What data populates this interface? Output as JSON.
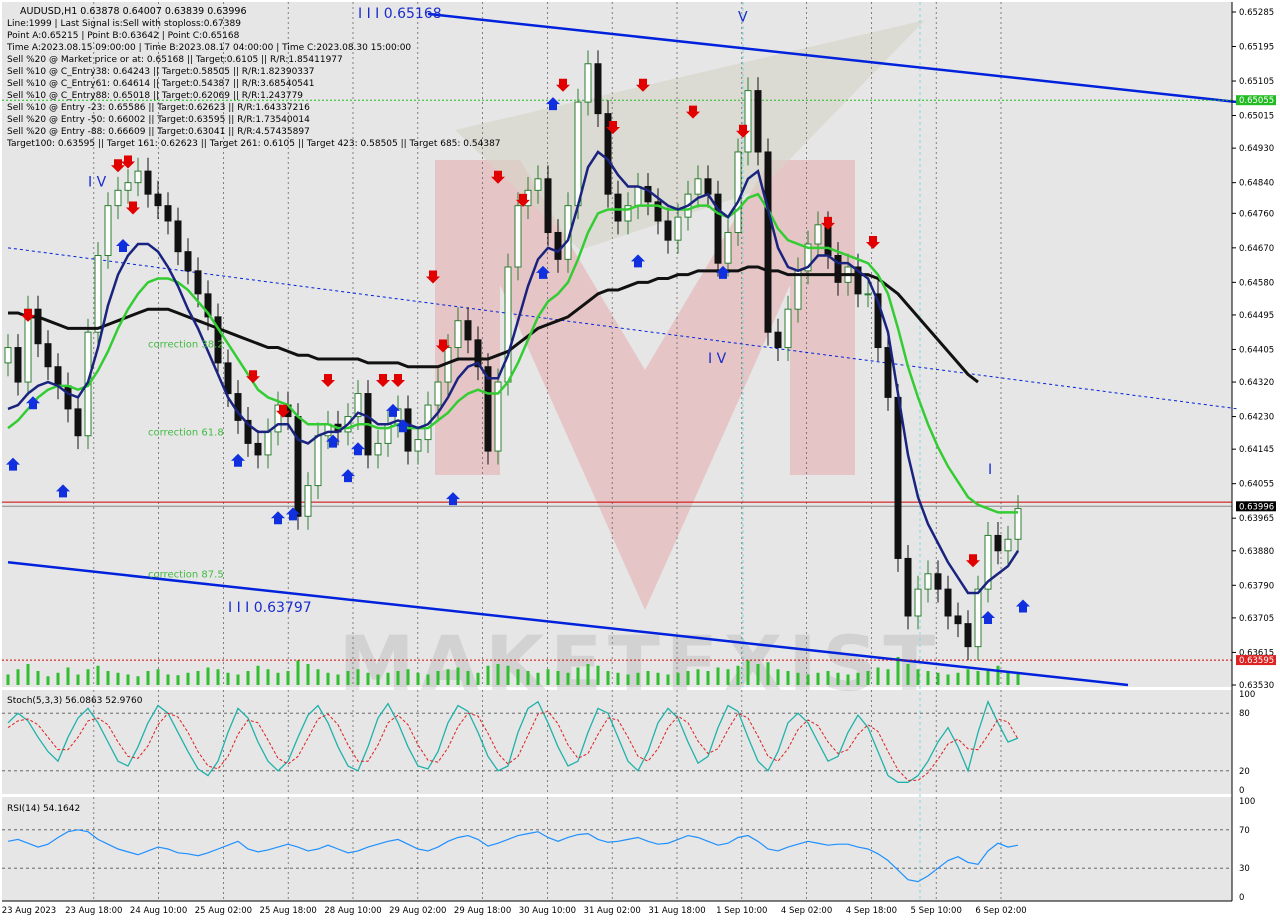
{
  "header": {
    "symbol_line": "AUDUSD,H1  0.63878 0.64007 0.63839 0.63996",
    "lines": [
      "Line:1999 | Last Signal is:Sell with stoploss:0.67389",
      "Point A:0.65215 | Point B:0.63642 | Point C:0.65168",
      "Time A:2023.08.15 09:00:00 | Time B:2023.08.17 04:00:00 | Time C:2023.08.30 15:00:00",
      "Sell %20 @ Market price or at: 0.65168 || Target:0.6105 || R/R:1.85411977",
      "Sell %10 @ C_Entry38: 0.64243 || Target:0.58505 || R/R:1.82390337",
      "Sell %10 @ C_Entry61: 0.64614 || Target:0.54387 || R/R:3.68540541",
      "Sell %10 @ C_Entry88: 0.65018 || Target:0.62069 || R/R:1.243779",
      "Sell %10 @ Entry -23: 0.65586 || Target:0.62623 || R/R:1.64337216",
      "Sell %20 @ Entry -50: 0.66002 || Target:0.63595 || R/R:1.73540014",
      "Sell %20 @ Entry -88: 0.66609 || Target:0.63041 || R/R:4.57435897",
      "Target100: 0.63595 || Target 161: 0.62623 || Target 261: 0.6105 || Target 423: 0.58505 || Target 685: 0.54387"
    ]
  },
  "wave_labels": [
    {
      "text": "I I I 0.65168",
      "t": 35,
      "p": 0.6527
    },
    {
      "text": "V",
      "t": 73,
      "p": 0.6526
    },
    {
      "text": "I V",
      "t": 8,
      "p": 0.6483
    },
    {
      "text": "I V",
      "t": 70,
      "p": 0.6437
    },
    {
      "text": "I",
      "t": 98,
      "p": 0.6408
    },
    {
      "text": "I I I 0.63797",
      "t": 22,
      "p": 0.6372
    }
  ],
  "corrections": [
    {
      "text": "correction 38.2",
      "t": 14,
      "p": 0.6441
    },
    {
      "text": "correction 61.8",
      "t": 14,
      "p": 0.6418
    },
    {
      "text": "correction 87.5",
      "t": 14,
      "p": 0.6381
    }
  ],
  "watermark": "MAKETFXIST",
  "price_axis": {
    "ticks": [
      "0.65285",
      "0.65195",
      "0.65105",
      "0.65015",
      "0.64930",
      "0.64840",
      "0.64760",
      "0.64670",
      "0.64580",
      "0.64495",
      "0.64405",
      "0.64320",
      "0.64230",
      "0.64145",
      "0.64055",
      "0.63965",
      "0.63880",
      "0.63790",
      "0.63705",
      "0.63615",
      "0.63530"
    ],
    "current_price": "0.63996",
    "red_level": "0.64007",
    "green_level": "0.65055",
    "bottom_level": "0.63595"
  },
  "time_axis": [
    "23 Aug 2023",
    "23 Aug 18:00",
    "24 Aug 10:00",
    "25 Aug 02:00",
    "25 Aug 18:00",
    "28 Aug 10:00",
    "29 Aug 02:00",
    "29 Aug 18:00",
    "30 Aug 10:00",
    "31 Aug 02:00",
    "31 Aug 18:00",
    "1 Sep 10:00",
    "4 Sep 02:00",
    "4 Sep 18:00",
    "5 Sep 10:00",
    "6 Sep 02:00"
  ],
  "stoch": {
    "label": "Stoch(5,3,3) 56.0863 52.9760",
    "levels": [
      "100",
      "80",
      "20",
      "0"
    ]
  },
  "rsi": {
    "label": "RSI(14) 54.1642",
    "levels": [
      "100",
      "70",
      "30",
      "0"
    ]
  },
  "colors": {
    "bull_candle": "#2e7d32",
    "bear_candle": "#111111",
    "ma_fast": "#1a237e",
    "ma_green": "#33cc33",
    "ma_black": "#111111",
    "channel": "#0022dd",
    "signal_red": "#e00000",
    "signal_blue": "#1030e0",
    "stoch_main": "#20b2aa",
    "stoch_signal": "#e02020",
    "rsi": "#1e90ff",
    "red_line": "#cc0000",
    "green_line": "#22bb22"
  },
  "chart_data": {
    "type": "candlestick",
    "symbol": "AUDUSD",
    "timeframe": "H1",
    "ohlc_last": {
      "open": 0.63878,
      "high": 0.64007,
      "low": 0.63839,
      "close": 0.63996
    },
    "ylim": [
      0.6353,
      0.65285
    ],
    "close": [
      0.6441,
      0.6432,
      0.6451,
      0.6442,
      0.6436,
      0.6431,
      0.6425,
      0.6418,
      0.6445,
      0.6465,
      0.6478,
      0.6482,
      0.6484,
      0.6487,
      0.6481,
      0.6478,
      0.6474,
      0.6466,
      0.6461,
      0.6455,
      0.6449,
      0.6437,
      0.6429,
      0.6422,
      0.6416,
      0.6413,
      0.6419,
      0.6426,
      0.6423,
      0.6397,
      0.6405,
      0.6418,
      0.6421,
      0.6419,
      0.6423,
      0.6429,
      0.6413,
      0.6416,
      0.6421,
      0.6425,
      0.6414,
      0.6417,
      0.6426,
      0.6432,
      0.6441,
      0.6448,
      0.6443,
      0.6436,
      0.6414,
      0.6432,
      0.6462,
      0.6478,
      0.6482,
      0.6485,
      0.6471,
      0.6464,
      0.6478,
      0.6505,
      0.6515,
      0.6502,
      0.6481,
      0.6474,
      0.6478,
      0.6483,
      0.6479,
      0.6474,
      0.6469,
      0.6475,
      0.6481,
      0.6485,
      0.6481,
      0.6463,
      0.6471,
      0.6492,
      0.6508,
      0.6492,
      0.6445,
      0.6441,
      0.6451,
      0.6461,
      0.6468,
      0.6473,
      0.6465,
      0.6458,
      0.6462,
      0.6455,
      0.6455,
      0.6441,
      0.6428,
      0.6386,
      0.6371,
      0.6378,
      0.6382,
      0.6378,
      0.6371,
      0.6369,
      0.6363,
      0.6378,
      0.6392,
      0.6388,
      0.6391,
      0.6399
    ],
    "ma_dark_blue": [
      0.6425,
      0.6426,
      0.6429,
      0.6431,
      0.6432,
      0.6431,
      0.6429,
      0.6428,
      0.6432,
      0.6441,
      0.6452,
      0.646,
      0.6465,
      0.6468,
      0.6468,
      0.6466,
      0.6462,
      0.6457,
      0.6451,
      0.6446,
      0.644,
      0.6434,
      0.6428,
      0.6424,
      0.6421,
      0.6419,
      0.6419,
      0.6421,
      0.6421,
      0.6417,
      0.6416,
      0.6418,
      0.6419,
      0.6419,
      0.6421,
      0.6424,
      0.6423,
      0.6421,
      0.6421,
      0.6422,
      0.6421,
      0.642,
      0.6421,
      0.6424,
      0.6428,
      0.6433,
      0.6436,
      0.6437,
      0.6433,
      0.6433,
      0.6439,
      0.6448,
      0.6457,
      0.6464,
      0.6467,
      0.6466,
      0.6469,
      0.6478,
      0.6488,
      0.6492,
      0.649,
      0.6486,
      0.6483,
      0.6483,
      0.6482,
      0.648,
      0.6478,
      0.6477,
      0.6478,
      0.648,
      0.6481,
      0.6477,
      0.6475,
      0.6479,
      0.6485,
      0.6487,
      0.6477,
      0.6467,
      0.6462,
      0.6461,
      0.6462,
      0.6465,
      0.6465,
      0.6463,
      0.6463,
      0.6461,
      0.6459,
      0.6453,
      0.6445,
      0.6429,
      0.6413,
      0.6402,
      0.6395,
      0.639,
      0.6385,
      0.6381,
      0.6377,
      0.6377,
      0.638,
      0.6382,
      0.6384,
      0.6388
    ],
    "ma_green": [
      0.642,
      0.6422,
      0.6425,
      0.6428,
      0.643,
      0.6431,
      0.6431,
      0.643,
      0.6431,
      0.6435,
      0.644,
      0.6446,
      0.6451,
      0.6455,
      0.6458,
      0.6459,
      0.6459,
      0.6458,
      0.6456,
      0.6453,
      0.645,
      0.6446,
      0.6442,
      0.6438,
      0.6434,
      0.643,
      0.6428,
      0.6427,
      0.6426,
      0.6423,
      0.6421,
      0.6421,
      0.6421,
      0.642,
      0.642,
      0.6421,
      0.6421,
      0.642,
      0.642,
      0.6421,
      0.642,
      0.642,
      0.642,
      0.6422,
      0.6424,
      0.6427,
      0.6429,
      0.643,
      0.6429,
      0.6429,
      0.6432,
      0.6437,
      0.6443,
      0.6449,
      0.6453,
      0.6455,
      0.6458,
      0.6464,
      0.6471,
      0.6476,
      0.6477,
      0.6477,
      0.6477,
      0.6478,
      0.6478,
      0.6478,
      0.6477,
      0.6477,
      0.6477,
      0.6478,
      0.6478,
      0.6476,
      0.6475,
      0.6477,
      0.648,
      0.6481,
      0.6477,
      0.6472,
      0.6469,
      0.6468,
      0.6467,
      0.6467,
      0.6467,
      0.6466,
      0.6465,
      0.6464,
      0.6463,
      0.646,
      0.6455,
      0.6446,
      0.6436,
      0.6428,
      0.6421,
      0.6415,
      0.641,
      0.6406,
      0.6402,
      0.64,
      0.6399,
      0.6398,
      0.6398,
      0.6398
    ],
    "ma_black": [
      0.645,
      0.645,
      0.6449,
      0.6449,
      0.6448,
      0.6447,
      0.6446,
      0.6446,
      0.6446,
      0.6446,
      0.6447,
      0.6448,
      0.6449,
      0.645,
      0.6451,
      0.6451,
      0.6451,
      0.645,
      0.6449,
      0.6448,
      0.6447,
      0.6446,
      0.6445,
      0.6444,
      0.6443,
      0.6442,
      0.6441,
      0.6441,
      0.644,
      0.6439,
      0.6439,
      0.6438,
      0.6438,
      0.6438,
      0.6438,
      0.6438,
      0.6437,
      0.6437,
      0.6437,
      0.6437,
      0.6436,
      0.6436,
      0.6436,
      0.6436,
      0.6437,
      0.6438,
      0.6438,
      0.6438,
      0.6438,
      0.6439,
      0.644,
      0.6442,
      0.6444,
      0.6446,
      0.6447,
      0.6448,
      0.6449,
      0.6451,
      0.6453,
      0.6455,
      0.6456,
      0.6456,
      0.6457,
      0.6458,
      0.6458,
      0.6459,
      0.6459,
      0.646,
      0.646,
      0.6461,
      0.6461,
      0.6461,
      0.6461,
      0.6461,
      0.6462,
      0.6462,
      0.6461,
      0.6461,
      0.646,
      0.646,
      0.646,
      0.646,
      0.646,
      0.646,
      0.646,
      0.646,
      0.646,
      0.6459,
      0.6457,
      0.6455,
      0.6452,
      0.6449,
      0.6446,
      0.6443,
      0.644,
      0.6437,
      0.6434,
      0.6432
    ],
    "channel_upper": [
      [
        42,
        0.6528
      ],
      [
        123,
        0.6505
      ]
    ],
    "channel_lower": [
      [
        0,
        0.6385
      ],
      [
        112,
        0.6353
      ]
    ],
    "channel_mid": [
      [
        0,
        0.6467
      ],
      [
        123,
        0.6425
      ]
    ],
    "sell_signals": [
      [
        2,
        0.6449
      ],
      [
        11,
        0.6488
      ],
      [
        12,
        0.6489
      ],
      [
        12.5,
        0.6477
      ],
      [
        24.5,
        0.6433
      ],
      [
        27.5,
        0.6424
      ],
      [
        32,
        0.6432
      ],
      [
        37.5,
        0.6432
      ],
      [
        39,
        0.6432
      ],
      [
        42.5,
        0.6459
      ],
      [
        43.5,
        0.6441
      ],
      [
        49,
        0.6485
      ],
      [
        51.5,
        0.6479
      ],
      [
        55.5,
        0.6509
      ],
      [
        60.5,
        0.6498
      ],
      [
        63.5,
        0.6509
      ],
      [
        68.5,
        0.6502
      ],
      [
        73.5,
        0.6497
      ],
      [
        82,
        0.6473
      ],
      [
        86.5,
        0.6468
      ],
      [
        96.5,
        0.6385
      ]
    ],
    "buy_signals": [
      [
        0.5,
        0.6411
      ],
      [
        2.5,
        0.6427
      ],
      [
        5.5,
        0.6404
      ],
      [
        11.5,
        0.6468
      ],
      [
        23,
        0.6412
      ],
      [
        27,
        0.6397
      ],
      [
        28.5,
        0.6398
      ],
      [
        32.5,
        0.6417
      ],
      [
        34,
        0.6408
      ],
      [
        35,
        0.6415
      ],
      [
        38.5,
        0.6425
      ],
      [
        39.5,
        0.6421
      ],
      [
        44.5,
        0.6402
      ],
      [
        53.5,
        0.6461
      ],
      [
        54.5,
        0.6505
      ],
      [
        63,
        0.6464
      ],
      [
        71.5,
        0.6461
      ],
      [
        98,
        0.6371
      ],
      [
        101.5,
        0.6374
      ]
    ],
    "stoch_k": [
      70,
      80,
      72,
      55,
      40,
      30,
      55,
      75,
      85,
      70,
      50,
      30,
      25,
      45,
      70,
      88,
      80,
      60,
      40,
      22,
      15,
      30,
      60,
      85,
      75,
      50,
      30,
      20,
      30,
      55,
      78,
      88,
      70,
      45,
      25,
      20,
      45,
      75,
      90,
      70,
      45,
      25,
      22,
      40,
      70,
      88,
      82,
      60,
      35,
      20,
      25,
      60,
      85,
      92,
      70,
      45,
      25,
      30,
      60,
      85,
      80,
      55,
      30,
      20,
      40,
      70,
      85,
      75,
      50,
      28,
      35,
      65,
      88,
      82,
      55,
      30,
      20,
      40,
      70,
      80,
      70,
      50,
      30,
      35,
      60,
      78,
      65,
      40,
      15,
      8,
      8,
      15,
      30,
      50,
      65,
      45,
      20,
      60,
      92,
      70,
      50,
      54
    ],
    "stoch_d": [
      65,
      72,
      74,
      68,
      55,
      42,
      42,
      55,
      72,
      75,
      68,
      50,
      35,
      33,
      46,
      68,
      80,
      76,
      60,
      40,
      25,
      22,
      35,
      58,
      73,
      70,
      52,
      33,
      27,
      35,
      54,
      74,
      79,
      68,
      47,
      30,
      30,
      47,
      70,
      78,
      68,
      47,
      31,
      29,
      44,
      66,
      80,
      77,
      59,
      38,
      27,
      35,
      57,
      79,
      82,
      69,
      47,
      33,
      38,
      58,
      75,
      73,
      55,
      35,
      30,
      43,
      65,
      77,
      70,
      51,
      38,
      43,
      63,
      80,
      75,
      56,
      35,
      30,
      43,
      63,
      73,
      67,
      50,
      38,
      42,
      58,
      68,
      61,
      40,
      21,
      10,
      10,
      18,
      32,
      48,
      53,
      43,
      42,
      57,
      74,
      71,
      53
    ],
    "rsi": [
      58,
      60,
      56,
      52,
      55,
      62,
      68,
      70,
      68,
      60,
      55,
      50,
      47,
      44,
      48,
      52,
      50,
      46,
      45,
      43,
      46,
      50,
      54,
      58,
      50,
      47,
      49,
      52,
      55,
      52,
      48,
      50,
      54,
      50,
      46,
      48,
      52,
      55,
      58,
      60,
      55,
      50,
      48,
      52,
      58,
      62,
      64,
      60,
      53,
      56,
      60,
      64,
      66,
      68,
      62,
      58,
      62,
      65,
      66,
      60,
      57,
      58,
      60,
      62,
      58,
      55,
      56,
      60,
      64,
      62,
      58,
      54,
      56,
      62,
      64,
      58,
      50,
      48,
      52,
      55,
      58,
      56,
      54,
      55,
      55,
      52,
      50,
      45,
      38,
      28,
      18,
      16,
      22,
      30,
      38,
      42,
      36,
      34,
      48,
      56,
      52,
      54
    ],
    "volume": [
      30,
      45,
      60,
      40,
      25,
      35,
      50,
      30,
      45,
      55,
      40,
      35,
      30,
      25,
      40,
      45,
      30,
      28,
      35,
      40,
      50,
      45,
      35,
      30,
      40,
      55,
      45,
      35,
      40,
      70,
      60,
      45,
      35,
      30,
      40,
      45,
      35,
      30,
      35,
      40,
      45,
      35,
      30,
      40,
      45,
      50,
      40,
      35,
      55,
      60,
      55,
      45,
      40,
      35,
      45,
      40,
      35,
      50,
      60,
      55,
      40,
      35,
      30,
      35,
      40,
      35,
      30,
      35,
      40,
      45,
      40,
      50,
      45,
      55,
      70,
      60,
      65,
      45,
      40,
      35,
      30,
      35,
      40,
      35,
      30,
      35,
      40,
      50,
      45,
      80,
      60,
      45,
      40,
      35,
      30,
      35,
      45,
      40,
      45,
      55,
      40,
      35
    ]
  }
}
